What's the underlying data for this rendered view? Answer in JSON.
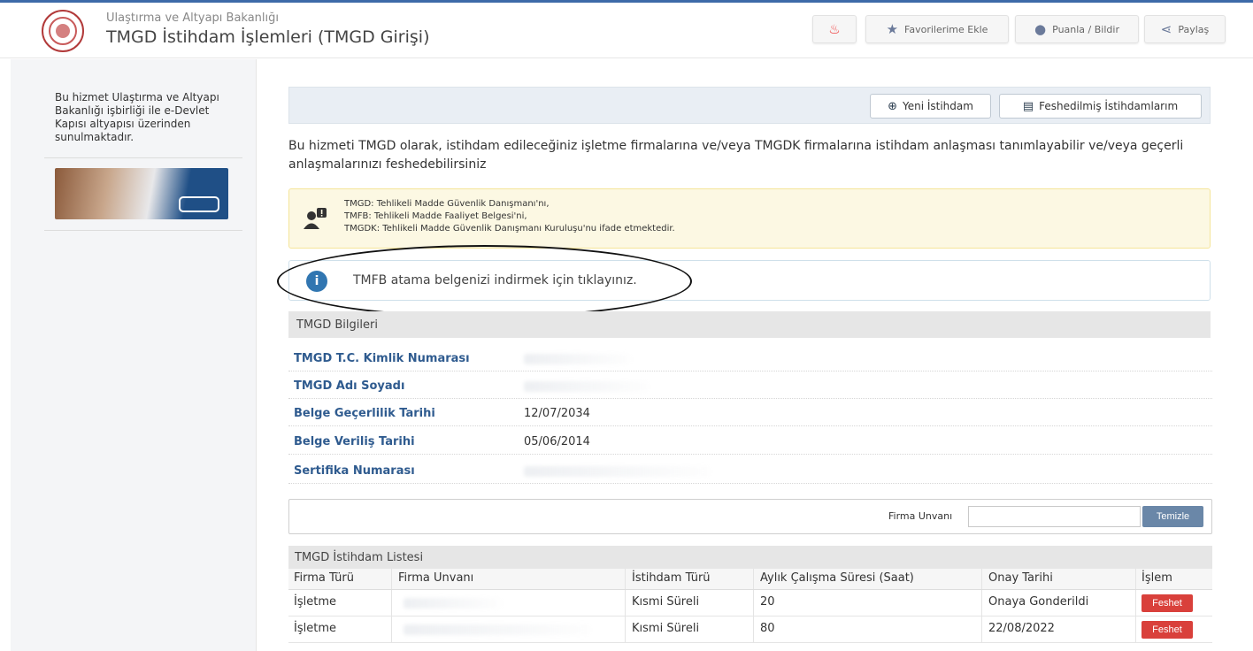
{
  "header": {
    "ministry": "Ulaştırma ve Altyapı Bakanlığı",
    "title": "TMGD İstihdam İşlemleri (TMGD Girişi)",
    "buttons": {
      "favorite": "Favorilerime Ekle",
      "rate": "Puanla / Bildir",
      "share": "Paylaş"
    }
  },
  "sidebar": {
    "text": "Bu hizmet Ulaştırma ve Altyapı Bakanlığı işbirliği ile e-Devlet Kapısı altyapısı üzerinden sunulmaktadır."
  },
  "toolbar": {
    "new": "Yeni İstihdam",
    "terminated": "Feshedilmiş İstihdamlarım"
  },
  "intro": "Bu hizmeti TMGD olarak, istihdam edileceğiniz işletme firmalarına ve/veya TMGDK firmalarına istihdam anlaşması tanımlayabilir ve/veya geçerli anlaşmalarınızı feshedebilirsiniz",
  "notice": {
    "line1": "TMGD: Tehlikeli Madde Güvenlik Danışmanı'nı,",
    "line2": "TMFB: Tehlikeli Madde Faaliyet Belgesi'ni,",
    "line3": "TMGDK: Tehlikeli Madde Güvenlik Danışmanı Kuruluşu'nu ifade etmektedir."
  },
  "info": "TMFB atama belgenizi indirmek için tıklayınız.",
  "tmgd_info": {
    "title": "TMGD Bilgileri",
    "fields": [
      {
        "label": "TMGD T.C. Kimlik Numarası",
        "value": ""
      },
      {
        "label": "TMGD Adı Soyadı",
        "value": ""
      },
      {
        "label": "Belge Geçerlilik Tarihi",
        "value": "12/07/2034"
      },
      {
        "label": "Belge Veriliş Tarihi",
        "value": "05/06/2014"
      },
      {
        "label": "Sertifika Numarası",
        "value": ""
      }
    ]
  },
  "filter": {
    "label": "Firma Unvanı",
    "value": "",
    "clear": "Temizle"
  },
  "table": {
    "title": "TMGD İstihdam Listesi",
    "columns": [
      "Firma Türü",
      "Firma Unvanı",
      "İstihdam Türü",
      "Aylık Çalışma Süresi (Saat)",
      "Onay Tarihi",
      "İşlem"
    ],
    "rows": [
      {
        "type": "İşletme",
        "name": "",
        "employment": "Kısmi Süreli",
        "hours": "20",
        "date": "Onaya Gonderildi",
        "action": "Feshet"
      },
      {
        "type": "İşletme",
        "name": "",
        "employment": "Kısmi Süreli",
        "hours": "80",
        "date": "22/08/2022",
        "action": "Feshet"
      }
    ]
  },
  "colors": {
    "accent": "#3176b1",
    "danger": "#d9403b",
    "link": "#2f5b8f"
  }
}
